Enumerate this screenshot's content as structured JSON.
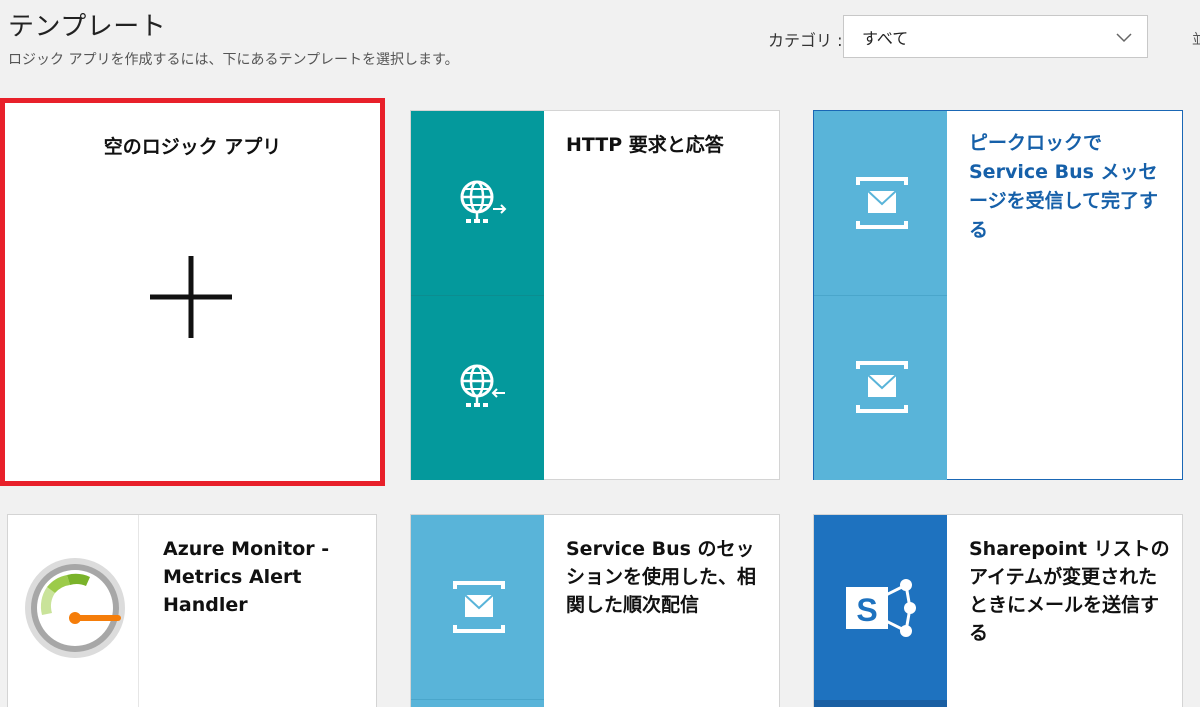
{
  "header": {
    "title": "テンプレート",
    "subtitle": "ロジック アプリを作成するには、下にあるテンプレートを選択します。",
    "category_label": "カテゴリ :",
    "category_value": "すべて",
    "edge_text": "並"
  },
  "templates": {
    "blank": {
      "title": "空のロジック アプリ"
    },
    "http": {
      "title": "HTTP 要求と応答"
    },
    "peeklock": {
      "title": "ピークロックで Service Bus メッセージを受信して完了する"
    },
    "monitor": {
      "title": "Azure Monitor - Metrics Alert Handler"
    },
    "session": {
      "title": "Service Bus のセッションを使用した、相関した順次配信"
    },
    "sharepoint": {
      "title": "Sharepoint リストのアイテムが変更されたときにメールを送信する"
    }
  },
  "colors": {
    "teal": "#04999c",
    "light_blue": "#59b4d9",
    "dark_blue": "#1e72bf",
    "selected_border": "#e8202a",
    "highlight_title": "#1660a9"
  },
  "icons": [
    "plus-icon",
    "http-request-icon",
    "http-response-icon",
    "service-bus-icon",
    "gauge-icon",
    "sharepoint-icon",
    "chevron-down-icon"
  ]
}
